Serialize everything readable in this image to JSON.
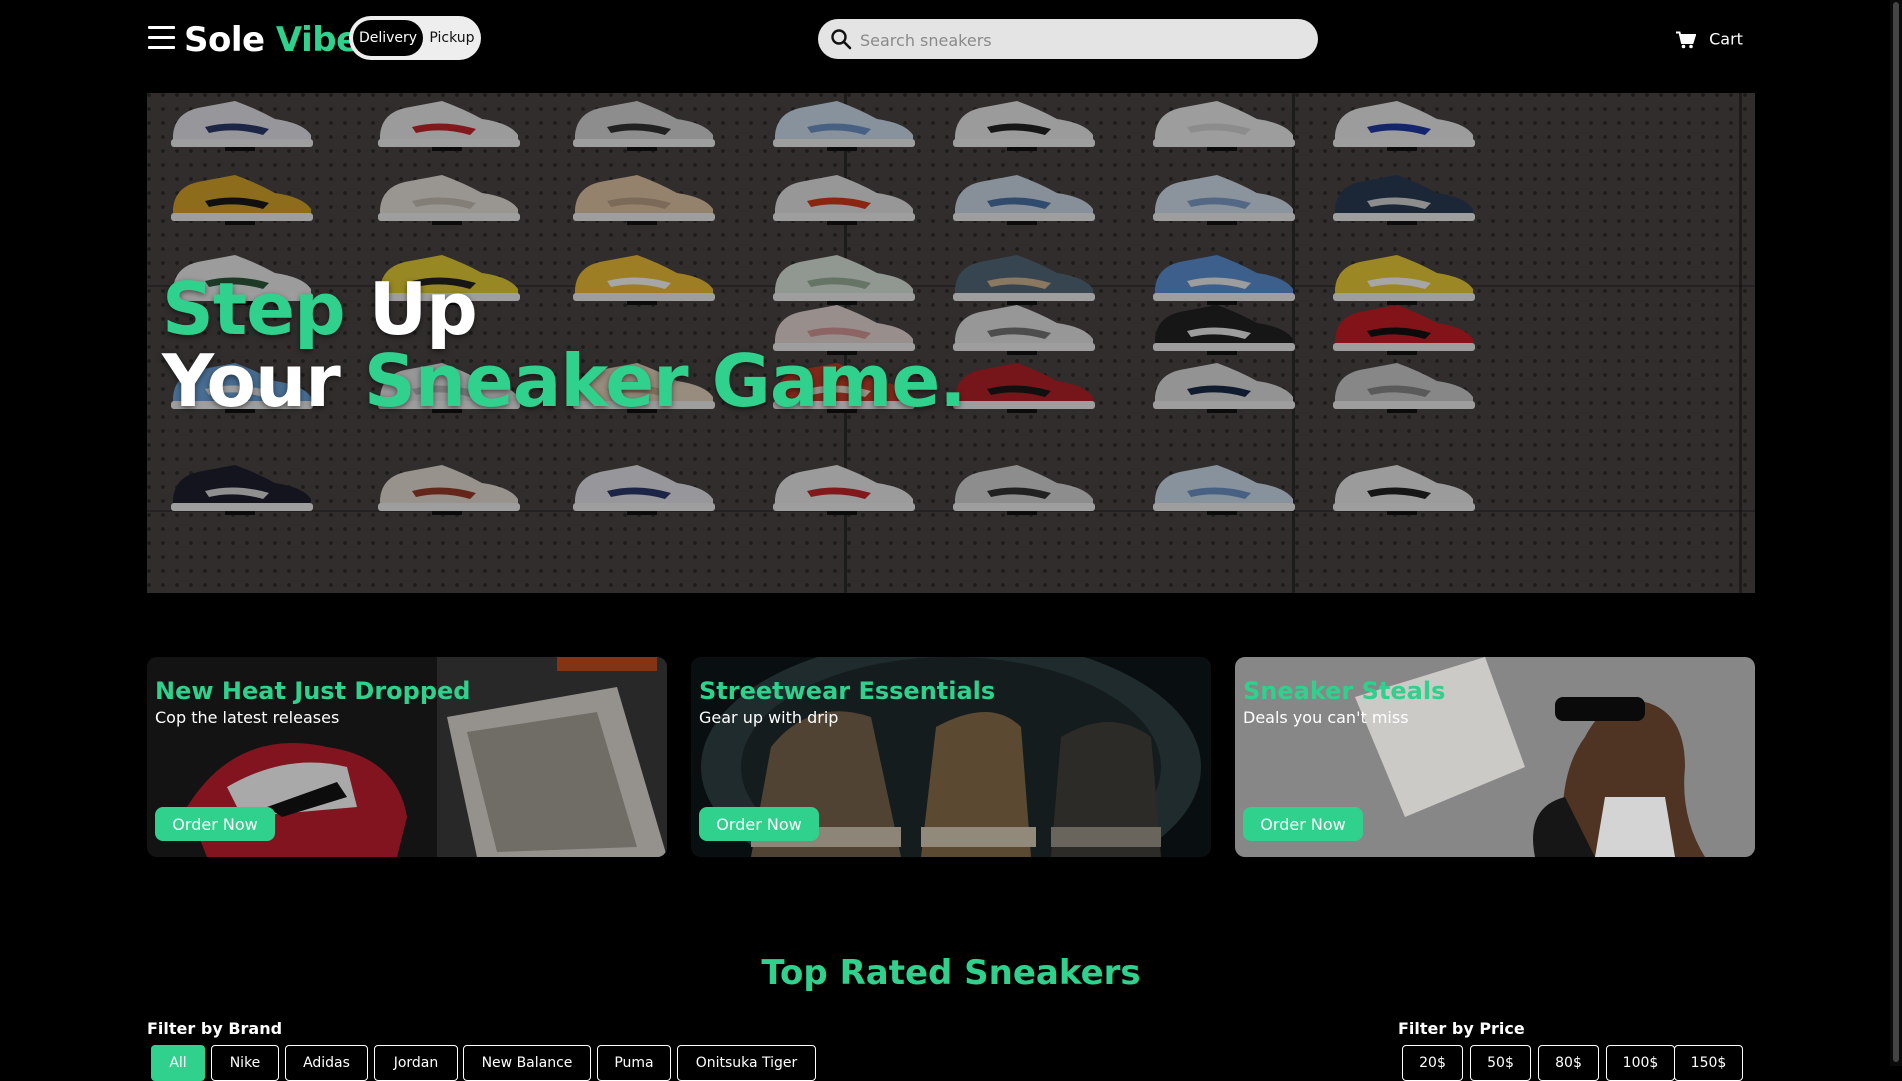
{
  "header": {
    "logo": {
      "word1": "Sole",
      "word2": "Vibe"
    },
    "mode": {
      "delivery": "Delivery",
      "pickup": "Pickup",
      "selected": "Delivery"
    },
    "search": {
      "placeholder": "Search sneakers",
      "value": ""
    },
    "cart_label": "Cart"
  },
  "hero": {
    "line1_accent": "Step",
    "line1_rest": "Up",
    "line2_start": "Your",
    "line2_accent": "Sneaker Game."
  },
  "promos": [
    {
      "title": "New Heat Just Dropped",
      "subtitle": "Cop the latest releases",
      "button": "Order Now"
    },
    {
      "title": "Streetwear Essentials",
      "subtitle": "Gear up with drip",
      "button": "Order Now"
    },
    {
      "title": "Sneaker Steals",
      "subtitle": "Deals you can't miss",
      "button": "Order Now"
    }
  ],
  "section": {
    "title": "Top Rated Sneakers",
    "brand_filter_label": "Filter by Brand",
    "brands": [
      "All",
      "Nike",
      "Adidas",
      "Jordan",
      "New Balance",
      "Puma",
      "Onitsuka Tiger"
    ],
    "selected_brand": "All",
    "price_filter_label": "Filter by Price",
    "prices": [
      "20$",
      "50$",
      "80$",
      "100$",
      "150$"
    ]
  },
  "colors": {
    "accent": "#2fd18d",
    "background": "#000000",
    "text": "#ffffff"
  },
  "icons": {
    "menu": "hamburger-icon",
    "search": "search-icon",
    "cart": "cart-icon"
  }
}
